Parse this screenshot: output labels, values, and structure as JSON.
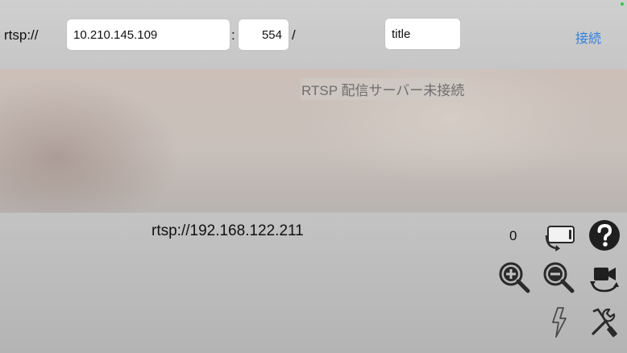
{
  "toolbar": {
    "scheme_label": "rtsp://",
    "host_value": "10.210.145.109",
    "port_separator": ":",
    "port_value": "554",
    "path_separator": "/",
    "path_value": "title",
    "connect_label": "接続"
  },
  "preview": {
    "status_text": "RTSP 配信サーバー未接続"
  },
  "panel": {
    "server_url": "rtsp://192.168.122.211",
    "counter": "0"
  },
  "icons": {
    "rotate_device": "rotate-device-icon",
    "help": "help-icon",
    "zoom_in": "zoom-in-icon",
    "zoom_out": "zoom-out-icon",
    "switch_camera": "switch-camera-icon",
    "flash": "flash-icon",
    "settings": "settings-tools-icon"
  },
  "colors": {
    "accent": "#2f7fe0",
    "status_dot": "#35c94a",
    "icon": "#2a2a2a"
  }
}
